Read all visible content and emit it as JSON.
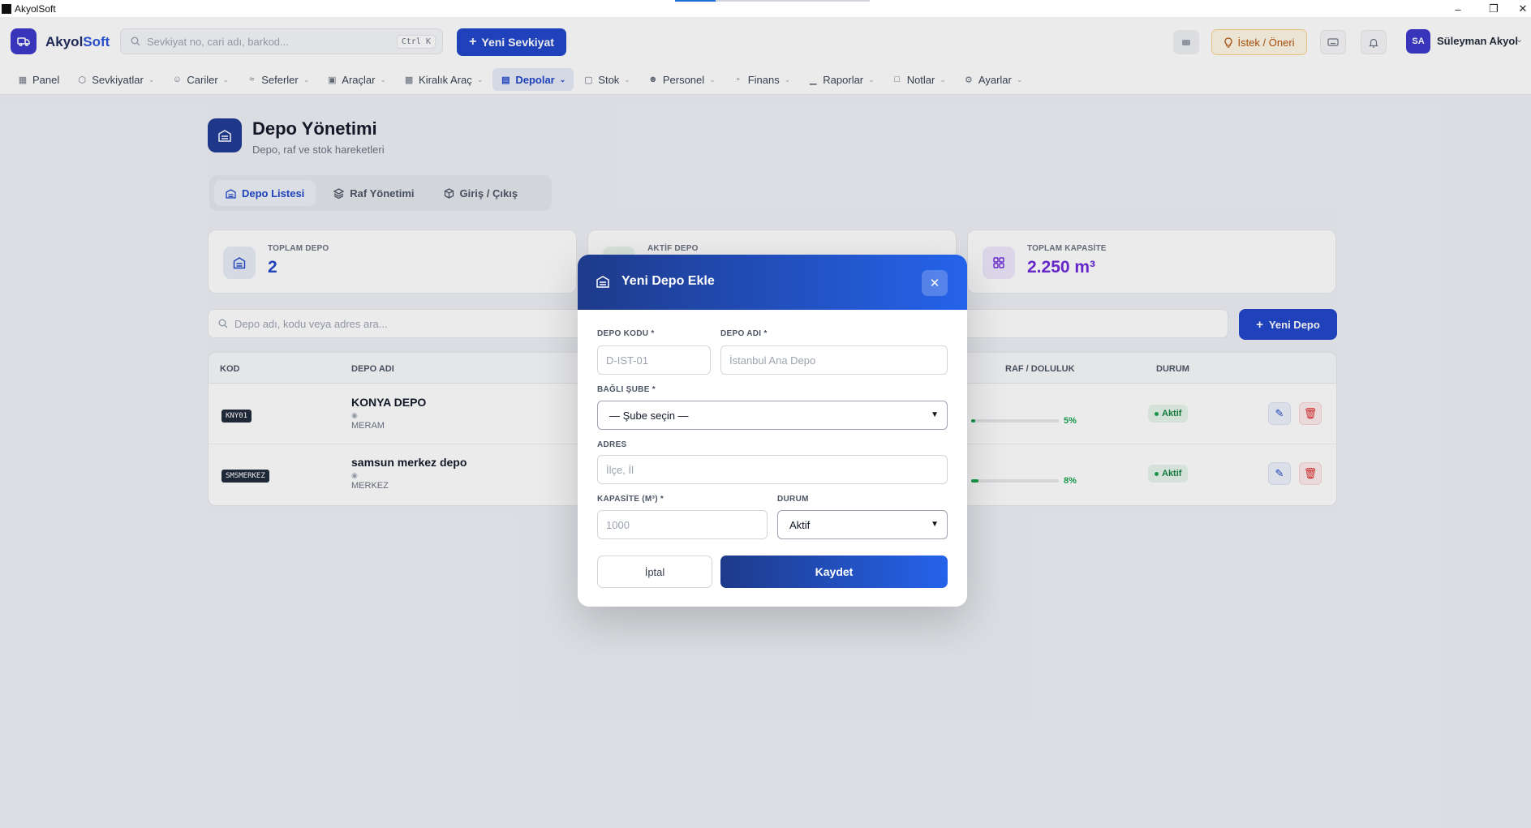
{
  "window": {
    "title": "AkyolSoft"
  },
  "header": {
    "brand_main": "Akyol",
    "brand_accent": "Soft",
    "search_placeholder": "Sevkiyat no, cari adı, barkod...",
    "search_shortcut": "Ctrl K",
    "new_shipment_label": "Yeni Sevkiyat",
    "suggestion_label": "İstek / Öneri",
    "user_initials": "SA",
    "user_name": "Süleyman Akyol"
  },
  "nav": [
    {
      "label": "Panel",
      "icon": "grid-icon",
      "dropdown": false
    },
    {
      "label": "Sevkiyatlar",
      "icon": "box-icon",
      "dropdown": true
    },
    {
      "label": "Cariler",
      "icon": "users-icon",
      "dropdown": true
    },
    {
      "label": "Seferler",
      "icon": "route-icon",
      "dropdown": true
    },
    {
      "label": "Araçlar",
      "icon": "truck-icon",
      "dropdown": true
    },
    {
      "label": "Kiralık Araç",
      "icon": "car-icon",
      "dropdown": true
    },
    {
      "label": "Depolar",
      "icon": "warehouse-icon",
      "dropdown": true,
      "active": true
    },
    {
      "label": "Stok",
      "icon": "package-icon",
      "dropdown": true
    },
    {
      "label": "Personel",
      "icon": "user-cog-icon",
      "dropdown": true
    },
    {
      "label": "Finans",
      "icon": "wallet-icon",
      "dropdown": true
    },
    {
      "label": "Raporlar",
      "icon": "bar-chart-icon",
      "dropdown": true
    },
    {
      "label": "Notlar",
      "icon": "note-icon",
      "dropdown": true
    },
    {
      "label": "Ayarlar",
      "icon": "settings-icon",
      "dropdown": true
    }
  ],
  "page": {
    "title": "Depo Yönetimi",
    "subtitle": "Depo, raf ve stok hareketleri",
    "tabs": [
      "Depo Listesi",
      "Raf Yönetimi",
      "Giriş / Çıkış"
    ]
  },
  "stats": [
    {
      "label": "TOPLAM DEPO",
      "value": "2",
      "color": "#1f46c8"
    },
    {
      "label": "AKTİF DEPO",
      "value": "",
      "color": "#16a34a"
    },
    {
      "label": "TOPLAM KAPASİTE",
      "value": "2.250 m³",
      "color": "#6d28d9"
    }
  ],
  "list": {
    "search_placeholder": "Depo adı, kodu veya adres ara...",
    "new_button": "Yeni Depo",
    "columns": {
      "code": "KOD",
      "name": "DEPO ADI",
      "fill": "RAF / DOLULUK",
      "status": "DURUM"
    },
    "rows": [
      {
        "code": "KNY01",
        "name": "KONYA DEPO",
        "district": "MERAM",
        "fill_percent": "5%",
        "fill": 0.05,
        "status": "Aktif"
      },
      {
        "code": "SMSMERKEZ",
        "name": "samsun merkez depo",
        "district": "MERKEZ",
        "fill_percent": "8%",
        "fill": 0.08,
        "status": "Aktif"
      }
    ]
  },
  "modal": {
    "title": "Yeni Depo Ekle",
    "code_label": "DEPO KODU *",
    "code_placeholder": "D-IST-01",
    "name_label": "DEPO ADI *",
    "name_placeholder": "İstanbul Ana Depo",
    "branch_label": "BAĞLI ŞUBE *",
    "branch_value": "— Şube seçin —",
    "address_label": "ADRES",
    "address_placeholder": "İlçe, İl",
    "capacity_label": "KAPASİTE (M³) *",
    "capacity_placeholder": "1000",
    "status_label": "DURUM",
    "status_value": "Aktif",
    "cancel_label": "İptal",
    "save_label": "Kaydet"
  }
}
